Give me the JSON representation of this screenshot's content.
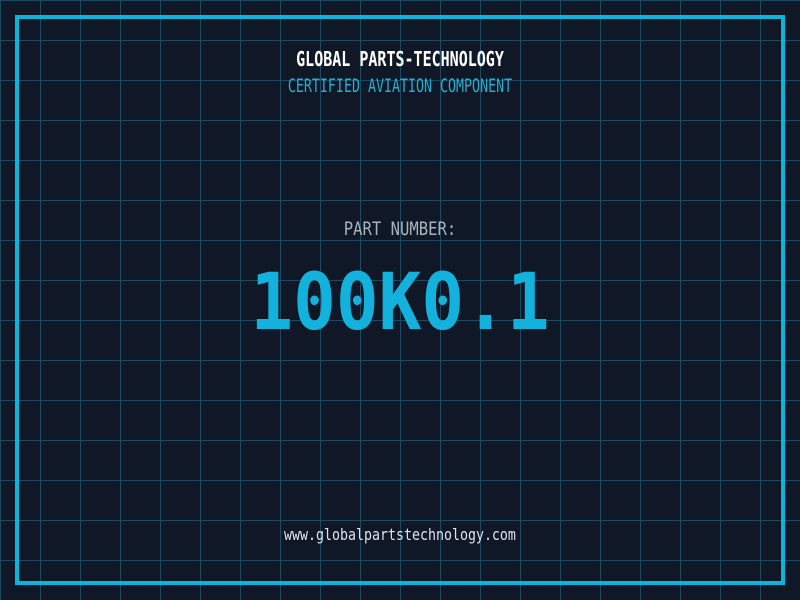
{
  "header": {
    "company": "GLOBAL PARTS-TECHNOLOGY",
    "tagline": "CERTIFIED AVIATION COMPONENT"
  },
  "part": {
    "label": "PART NUMBER:",
    "number": "100K0.1"
  },
  "footer": {
    "website": "www.globalpartstechnology.com"
  },
  "theme": {
    "background": "#101827",
    "grid_line": "#1c4a62",
    "frame_accent": "#0cb4da",
    "part_number_color": "#12b2dc",
    "tagline_color": "#2aaccd",
    "title_color": "#ffffff",
    "label_color": "#a9b3bd",
    "website_color": "#dde5eb"
  }
}
